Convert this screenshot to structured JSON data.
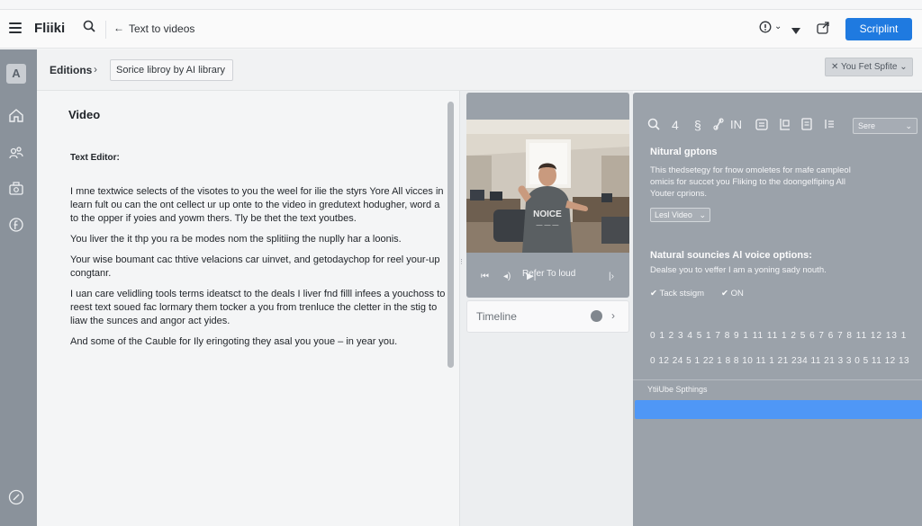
{
  "topbar": {
    "brand": "Fliiki",
    "breadcrumb": "Text to videos",
    "primary_button": "Scriplint"
  },
  "subheader": {
    "editions": "Editions",
    "library_pill": "Sorice libroy by AI library",
    "right_button": "You Fet Spfite"
  },
  "editor": {
    "title": "Video",
    "label": "Text Editor:",
    "paragraphs": [
      "I mne textwice selects of the visotes to you the weel for ilie the styrs Yore All vicces in learn fult ou can the ont cellect ur up onte to the video in gredutext hodugher, word a to the opper if yoies and yowm thers. Tly be thet the text youtbes.",
      "You liver the it thp you ra be modes nom the splitiing the nuplly har a loonis.",
      "Your wise boumant cac thtive velacions car uinvet, and getodaychop for reel your-up congtanr.",
      "I uan care velidling tools terms ideatsct to the deals I liver fnd filll infees a youchoss to reest text soued fac lormary them tocker a you from trenluce the cletter in the stig to liaw the sunces and angor act yides.",
      "And some of the Cauble for Ily eringoting they asal you youe – in year you."
    ]
  },
  "video": {
    "overlay_text": "Refer To loud",
    "timeline_label": "Timeline"
  },
  "panel": {
    "select_value": "Sere",
    "section1_title": "Nitural gptons",
    "section1_text": "This thedsetegy for fnow omoletes for mafe campleol omicis for succet you Fliking to the doongelfiping All Youter cprions.",
    "dropdown_label": "Lesl Video",
    "section2_title": "Natural souncies Al voice options:",
    "section2_text": "Dealse you to veffer I am a yoning sady nouth.",
    "check1": "Tack stsigm",
    "check2": "ON",
    "numbers_row1": "0 1 2 3 4 5 1 7 8 9 1 11 11 1 2 5 6 7 6 7 8 11 12 13 1",
    "numbers_row2": "0 12 24 5 1 22 1 8 8 10 11 1 21 234 11 21 3 3 0 5 11 12 13",
    "settings_label": "YtiiUbe Spthings"
  },
  "colors": {
    "accent": "#1f7ae0",
    "panel": "#9ba2aa",
    "rail": "#8a929b",
    "highlight_bar": "#4f97f6"
  }
}
